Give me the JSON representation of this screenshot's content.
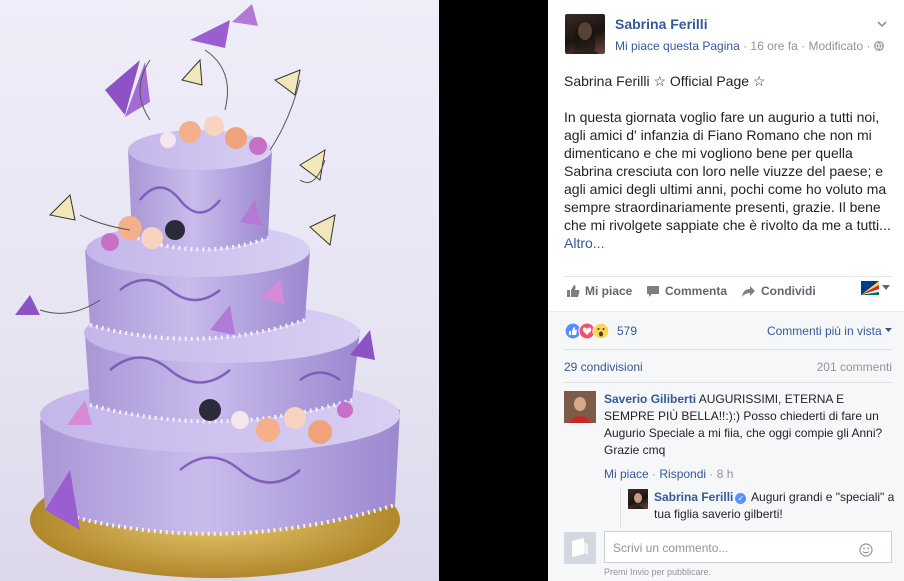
{
  "post": {
    "page_name": "Sabrina Ferilli",
    "like_page": "Mi piace questa Pagina",
    "separator": " · ",
    "time": "16 ore fa",
    "edited": "Modificato",
    "title_line": "Sabrina Ferilli ☆ Official Page ☆",
    "body": "In questa giornata voglio fare un augurio a tutti noi, agli amici d' infanzia di Fiano Romano che non mi dimenticano e che mi vogliono bene per quella Sabrina cresciuta con loro nelle viuzze del paese; e agli amici degli ultimi anni, pochi come ho voluto ma sempre straordinariamente presenti, grazie. Il bene che mi rivolgete sappiate che è rivolto da me a tutti...",
    "more": "Altro..."
  },
  "actions": {
    "like": "Mi piace",
    "comment": "Commenta",
    "share": "Condividi"
  },
  "reactions": {
    "count": "579",
    "sort": "Commenti più in vista",
    "icons": [
      "like-reaction-icon",
      "love-reaction-icon",
      "wow-reaction-icon"
    ]
  },
  "stats": {
    "shares": "29 condivisioni",
    "comments": "201 commenti"
  },
  "comment": {
    "author": "Saverio Giliberti",
    "text": "AUGURISSIMI, ETERNA E SEMPRE PIÙ BELLA!!:):) Posso chiederti di fare un Augurio Speciale a mi fiia, che oggi compie gli Anni? Grazie cmq",
    "like": "Mi piace",
    "reply": "Rispondi",
    "time": "8 h"
  },
  "reply": {
    "author": "Sabrina Ferilli",
    "text": "Auguri grandi e \"speciali\" a tua figlia saverio gilberti!"
  },
  "compose": {
    "placeholder": "Scrivi un commento...",
    "hint": "Premi Invio per pubblicare."
  },
  "colors": {
    "link": "#365899",
    "meta": "#90949c",
    "cake_purple": "#b8a6de"
  }
}
